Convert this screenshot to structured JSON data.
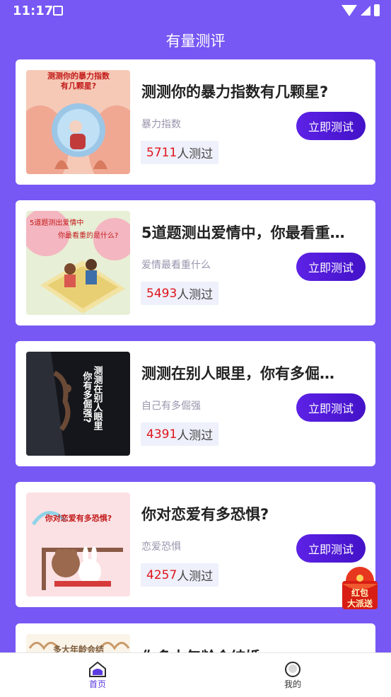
{
  "status_bar": {
    "time": "11:17"
  },
  "header": {
    "title": "有量测评"
  },
  "cards": [
    {
      "title": "测测你的暴力指数有几颗星?",
      "tag": "暴力指数",
      "count": "5711",
      "count_suffix": "人测过",
      "button": "立即测试",
      "image_text_line1": "测测你的暴力指数",
      "image_text_line2": "有几颗星?"
    },
    {
      "title": "5道题测出爱情中，你最看重…",
      "tag": "爱情最看重什么",
      "count": "5493",
      "count_suffix": "人测过",
      "button": "立即测试",
      "image_text_line1": "5道题测出爱情中",
      "image_text_line2": "你最看重的是什么?"
    },
    {
      "title": "测测在别人眼里，你有多倔…",
      "tag": "自己有多倔强",
      "count": "4391",
      "count_suffix": "人测过",
      "button": "立即测试",
      "image_text_line1": "测测在别人眼里",
      "image_text_line2": "你有多倔强?"
    },
    {
      "title": "你对恋爱有多恐惧?",
      "tag": "恋爱恐惧",
      "count": "4257",
      "count_suffix": "人测过",
      "button": "立即测试",
      "image_text_line1": "你对恋爱有多恐惧?"
    },
    {
      "title": "你多大年龄会结婚",
      "image_text_line1": "多大年龄会结"
    }
  ],
  "red_packet": {
    "line1": "红包",
    "line2": "大派送"
  },
  "tabbar": {
    "home": {
      "label": "首页",
      "icon": "home-icon"
    },
    "mine": {
      "label": "我的",
      "icon": "profile-icon"
    }
  },
  "colors": {
    "accent": "#7758f4",
    "button": "#4a14d2",
    "count": "#e0141b"
  }
}
